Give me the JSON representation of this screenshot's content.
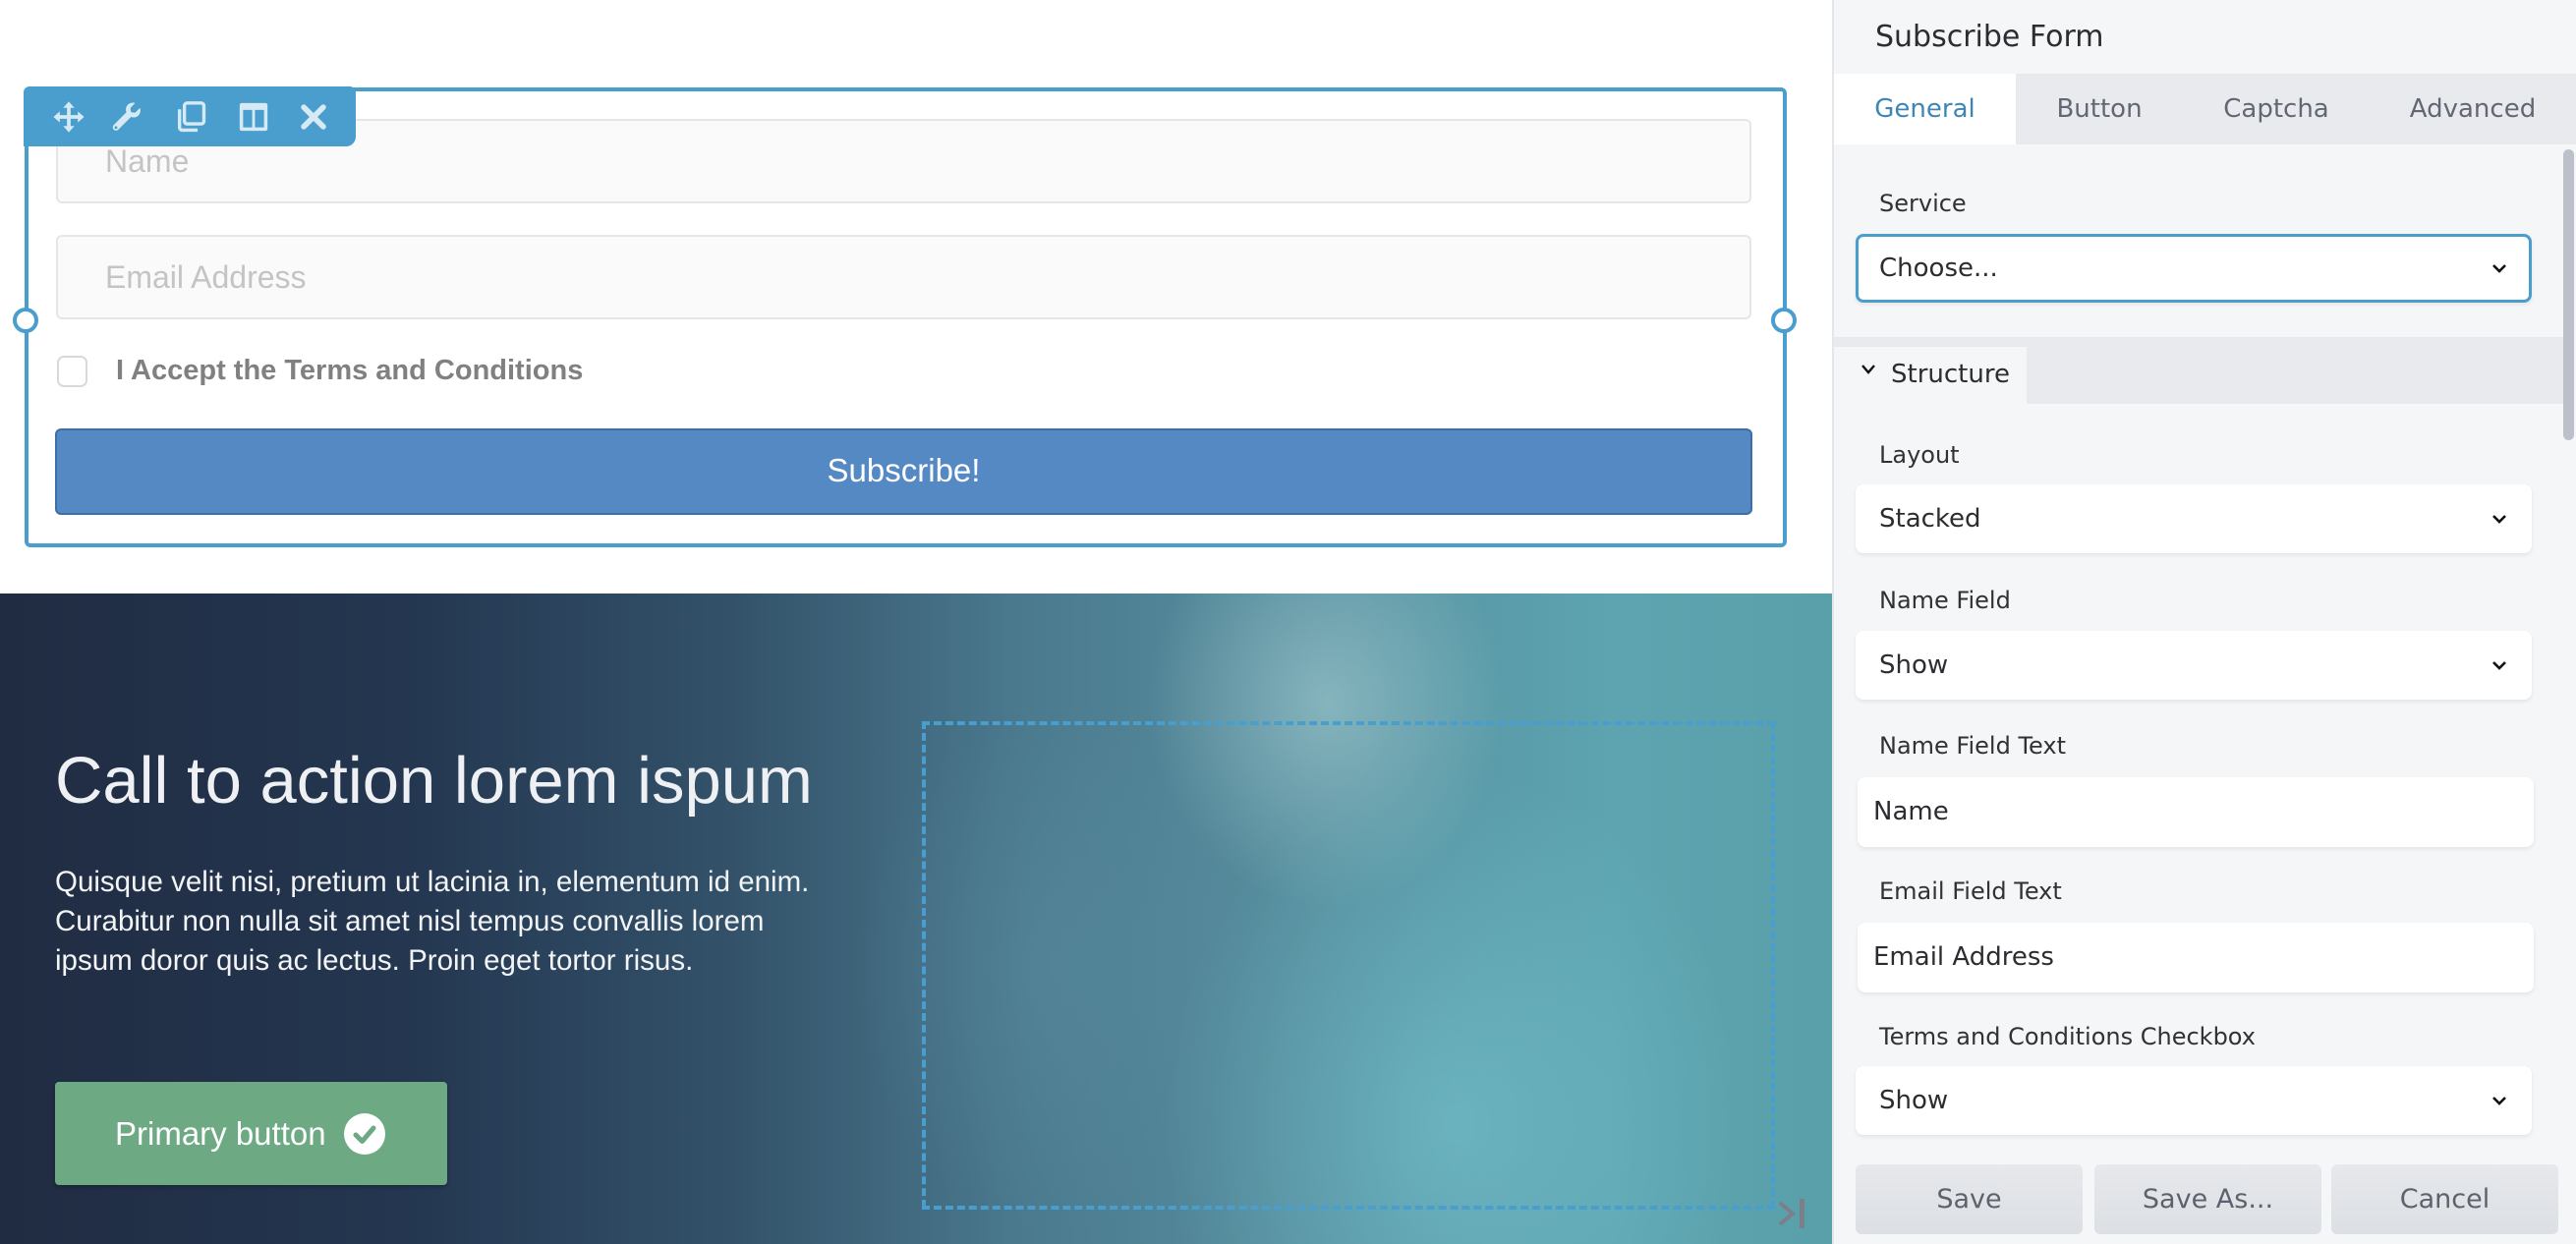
{
  "canvas": {
    "toolbar": {
      "icons": [
        "move-icon",
        "wrench-icon",
        "duplicate-icon",
        "columns-icon",
        "close-icon"
      ]
    },
    "form": {
      "name_placeholder": "Name",
      "email_placeholder": "Email Address",
      "terms_label": "I Accept the Terms and Conditions",
      "terms_checked": false,
      "submit_label": "Subscribe!"
    },
    "cta": {
      "heading": "Call to action lorem ispum",
      "body": "Quisque velit nisi, pretium ut lacinia in, elementum id enim. Curabitur non nulla sit amet nisl tempus convallis lorem ipsum doror quis ac lectus. Proin eget tortor risus.",
      "button_label": "Primary button",
      "button_icon": "check-circle-icon"
    },
    "colors": {
      "selection": "#4a9ecd",
      "submit_button": "#5589c4",
      "primary_button": "#6daa83"
    }
  },
  "panel": {
    "title": "Subscribe Form",
    "tabs": [
      {
        "label": "General",
        "active": true
      },
      {
        "label": "Button",
        "active": false
      },
      {
        "label": "Captcha",
        "active": false
      },
      {
        "label": "Advanced",
        "active": false
      }
    ],
    "service": {
      "label": "Service",
      "value": "Choose..."
    },
    "section_title": "Structure",
    "fields": {
      "layout": {
        "label": "Layout",
        "value": "Stacked"
      },
      "name_field": {
        "label": "Name Field",
        "value": "Show"
      },
      "name_field_text": {
        "label": "Name Field Text",
        "value": "Name"
      },
      "email_field_text": {
        "label": "Email Field Text",
        "value": "Email Address"
      },
      "terms_checkbox": {
        "label": "Terms and Conditions Checkbox",
        "value": "Show"
      }
    },
    "buttons": {
      "save": "Save",
      "save_as": "Save As...",
      "cancel": "Cancel"
    },
    "colors": {
      "active_tab_text": "#3e87b4",
      "focus_border": "#4a9ecd"
    }
  }
}
